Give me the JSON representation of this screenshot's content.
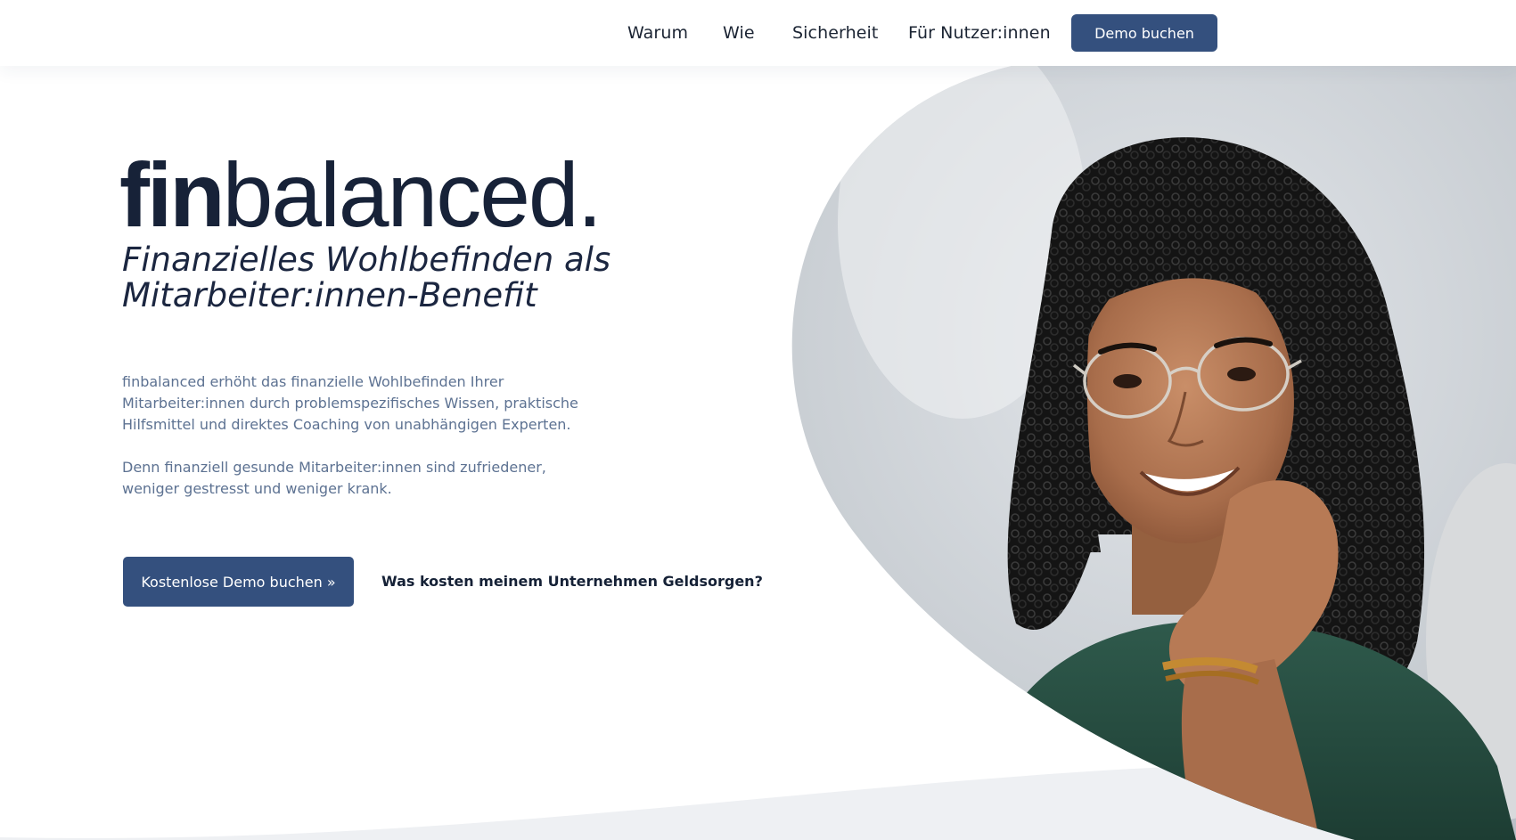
{
  "nav": {
    "items": [
      {
        "label": "Warum"
      },
      {
        "label": "Wie"
      },
      {
        "label": "Sicherheit"
      },
      {
        "label": "Für Nutzer:innen"
      }
    ],
    "demo_button": "Demo buchen"
  },
  "hero": {
    "logo_bold": "fin",
    "logo_regular": "balanced.",
    "subtitle": "Finanzielles Wohlbefinden als Mitarbeiter:innen-Benefit",
    "paragraph1": "finbalanced erhöht das finanzielle Wohlbefinden Ihrer Mitarbeiter:innen durch problemspezifisches Wissen, praktische Hilfsmittel und direktes Coaching von unabhängigen Experten.",
    "paragraph2": "Denn finanziell gesunde Mitarbeiter:innen sind zufriedener, weniger gestresst und weniger krank.",
    "cta_button": "Kostenlose Demo buchen »",
    "cost_link": "Was kosten meinem Unternehmen Geldsorgen?"
  },
  "colors": {
    "primary": "#34507e",
    "heading": "#172238",
    "body_text": "#5d7292"
  },
  "icons": {
    "hero_image": "smiling-woman-photo"
  }
}
